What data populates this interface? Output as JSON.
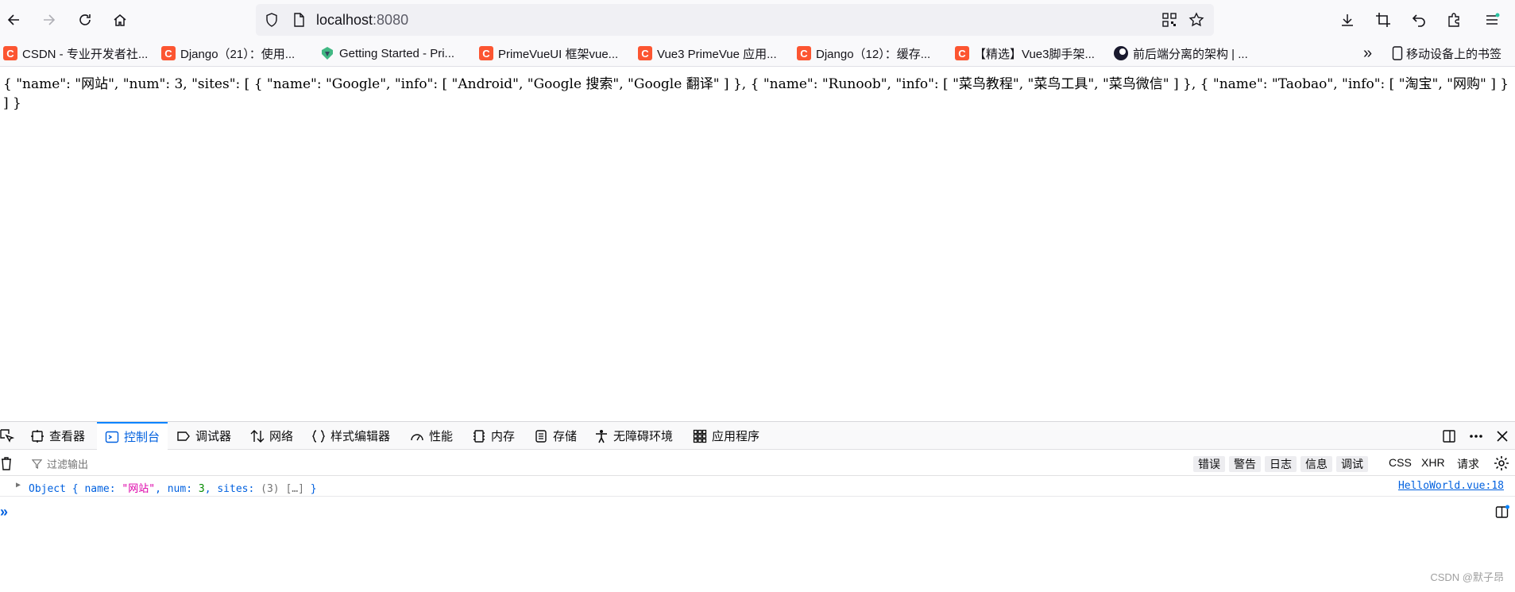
{
  "toolbar": {
    "url_host": "localhost",
    "url_port": ":8080"
  },
  "bookmarks": [
    {
      "label": "CSDN - 专业开发者社...",
      "icon": "csdn-icon"
    },
    {
      "label": "Django（21）：使用...",
      "icon": "csdn-icon"
    },
    {
      "label": "Getting Started - Pri...",
      "icon": "primevue-icon"
    },
    {
      "label": "PrimeVueUI 框架vue...",
      "icon": "csdn-icon"
    },
    {
      "label": "Vue3 PrimeVue 应用...",
      "icon": "csdn-icon"
    },
    {
      "label": "Django（12）：缓存...",
      "icon": "csdn-icon"
    },
    {
      "label": "【精选】Vue3脚手架...",
      "icon": "csdn-icon"
    },
    {
      "label": "前后端分离的架构 | ...",
      "icon": "moon-icon"
    }
  ],
  "bookmarks_mobile": "移动设备上的书签",
  "page": {
    "json_text": "{ \"name\": \"网站\", \"num\": 3, \"sites\": [ { \"name\": \"Google\", \"info\": [ \"Android\", \"Google 搜索\", \"Google 翻译\" ] }, { \"name\": \"Runoob\", \"info\": [ \"菜鸟教程\", \"菜鸟工具\", \"菜鸟微信\" ] }, { \"name\": \"Taobao\", \"info\": [ \"淘宝\", \"网购\" ] } ] }"
  },
  "devtools": {
    "tabs": [
      {
        "label": "查看器",
        "icon": "inspector-icon"
      },
      {
        "label": "控制台",
        "icon": "console-icon"
      },
      {
        "label": "调试器",
        "icon": "debugger-icon"
      },
      {
        "label": "网络",
        "icon": "network-icon"
      },
      {
        "label": "样式编辑器",
        "icon": "style-editor-icon"
      },
      {
        "label": "性能",
        "icon": "performance-icon"
      },
      {
        "label": "内存",
        "icon": "memory-icon"
      },
      {
        "label": "存储",
        "icon": "storage-icon"
      },
      {
        "label": "无障碍环境",
        "icon": "accessibility-icon"
      },
      {
        "label": "应用程序",
        "icon": "application-icon"
      }
    ],
    "active_tab": "控制台",
    "filter_placeholder": "过滤输出",
    "levels": [
      "错误",
      "警告",
      "日志",
      "信息",
      "调试"
    ],
    "categories": [
      "CSS",
      "XHR",
      "请求"
    ],
    "log": {
      "prefix": "Object { name: ",
      "name_value": "\"网站\"",
      "mid1": ", num: ",
      "num_value": "3",
      "mid2": ", sites: ",
      "sites_summary": "(3) […]",
      "suffix": " }",
      "source": "HelloWorld.vue:18"
    },
    "prompt": "»"
  },
  "watermark": "CSDN @默子昂",
  "colors": {
    "accent": "#0060df",
    "csdn": "#fc5531",
    "string": "#dd00a9",
    "number": "#058b00"
  }
}
